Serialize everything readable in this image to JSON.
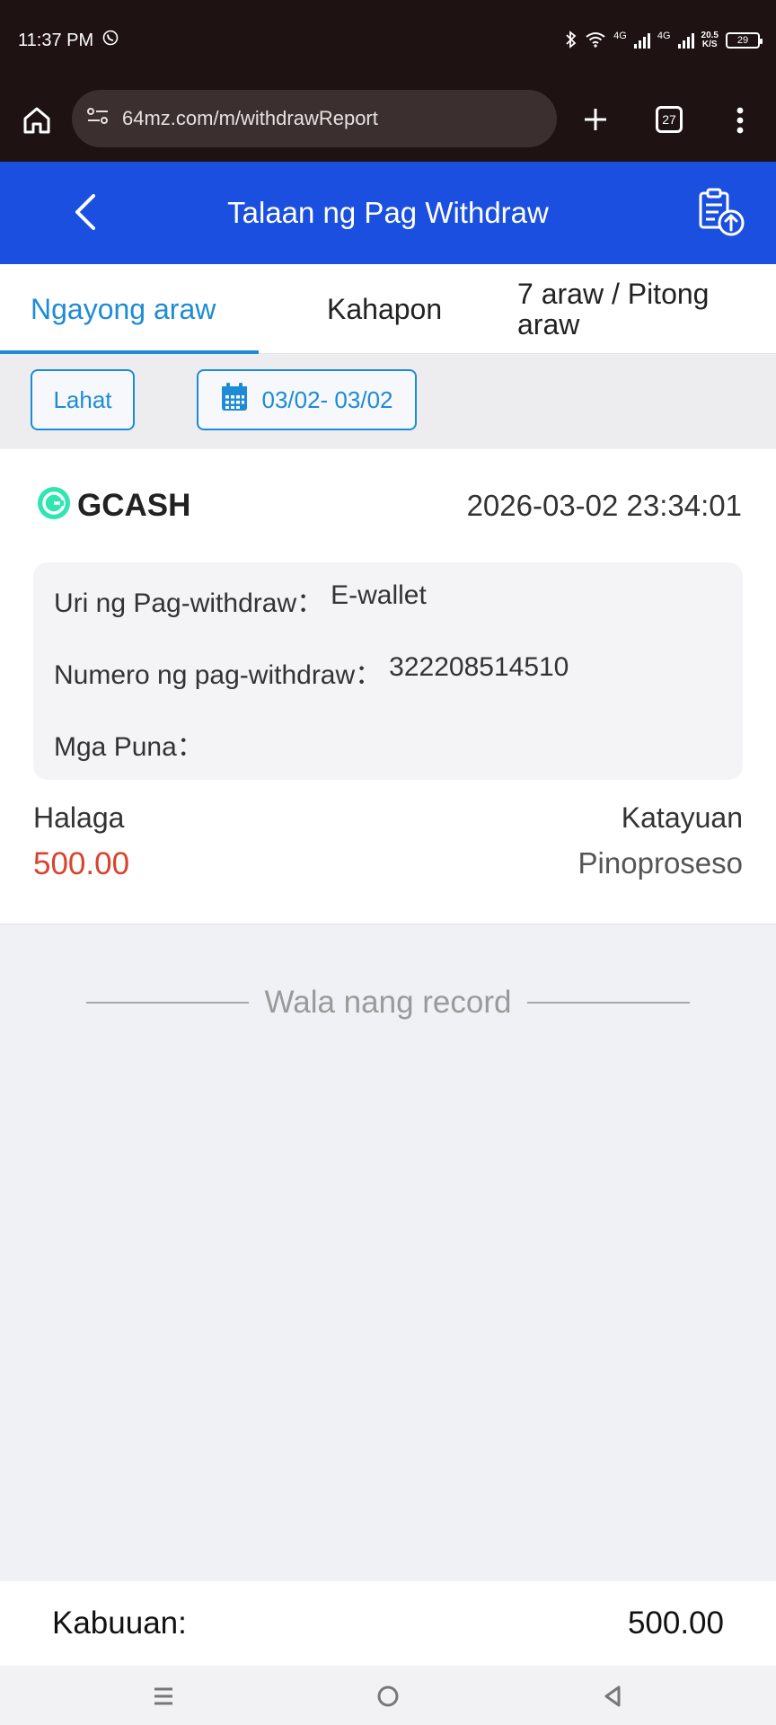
{
  "status_bar": {
    "time": "11:37 PM",
    "net_speed_top": "20.5",
    "net_speed_bottom": "K/S",
    "network_1": "4G",
    "network_2": "4G",
    "battery": "29"
  },
  "browser": {
    "url": "64mz.com/m/withdrawReport",
    "tab_count": "27"
  },
  "header": {
    "title": "Talaan ng Pag Withdraw"
  },
  "tabs": [
    {
      "label": "Ngayong araw",
      "active": true
    },
    {
      "label": "Kahapon",
      "active": false
    },
    {
      "label": "7 araw / Pitong araw",
      "active": false
    }
  ],
  "filters": {
    "type_label": "Lahat",
    "date_range": "03/02- 03/02"
  },
  "record": {
    "brand": "GCASH",
    "datetime": "2026-03-02 23:34:01",
    "details": {
      "type_label": "Uri ng Pag-withdraw：",
      "type_value": "E-wallet",
      "number_label": "Numero ng pag-withdraw：",
      "number_value": "322208514510",
      "remarks_label": "Mga Puna："
    },
    "amount_label": "Halaga",
    "amount_value": "500.00",
    "status_label": "Katayuan",
    "status_value": "Pinoproseso"
  },
  "list_end_text": "Wala nang record",
  "footer": {
    "total_label": "Kabuuan:",
    "total_value": "500.00"
  },
  "colors": {
    "accent": "#1a4fe0",
    "tab_active": "#1d8bd6",
    "amount": "#d9432e",
    "gcash": "#2ee6b0"
  }
}
